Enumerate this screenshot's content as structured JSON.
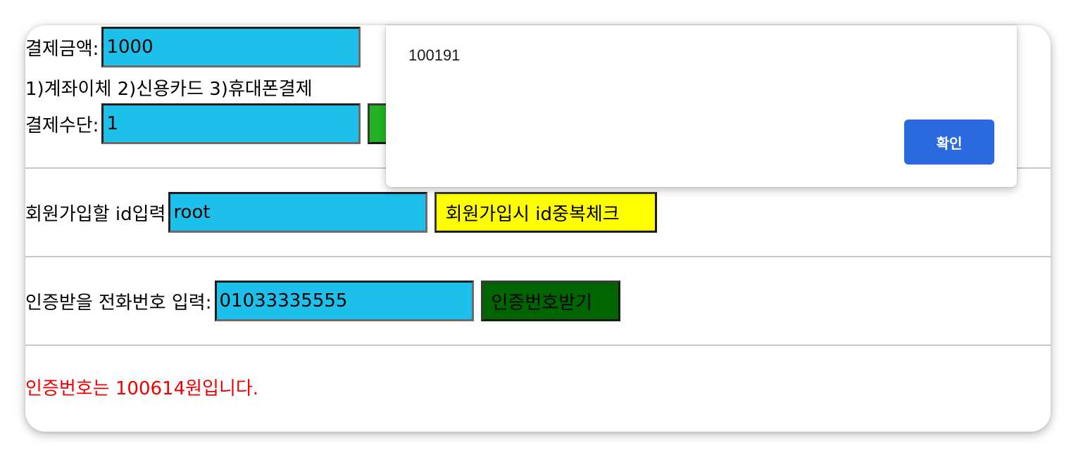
{
  "payment": {
    "amount_label": "결제금액:",
    "amount_value": "1000",
    "methods_text": "1)계좌이체 2)신용카드 3)휴대폰결제",
    "method_label": "결제수단:",
    "method_value": "1"
  },
  "signup": {
    "id_label": "회원가입할 id입력",
    "id_value": "root",
    "check_button": "회원가입시 id중복체크"
  },
  "verify": {
    "phone_label": "인증받을 전화번호 입력:",
    "phone_value": "01033335555",
    "send_button": "인증번호받기",
    "result_message": "인증번호는 100614원입니다."
  },
  "alert": {
    "message": "100191",
    "ok_label": "확인"
  },
  "colors": {
    "input_bg": "#1cc0ea",
    "check_button_bg": "#ffff00",
    "send_button_bg": "#006400",
    "hidden_button_bg": "#22b422",
    "result_text": "#f20000",
    "dialog_ok_bg": "#2a6ae0"
  }
}
